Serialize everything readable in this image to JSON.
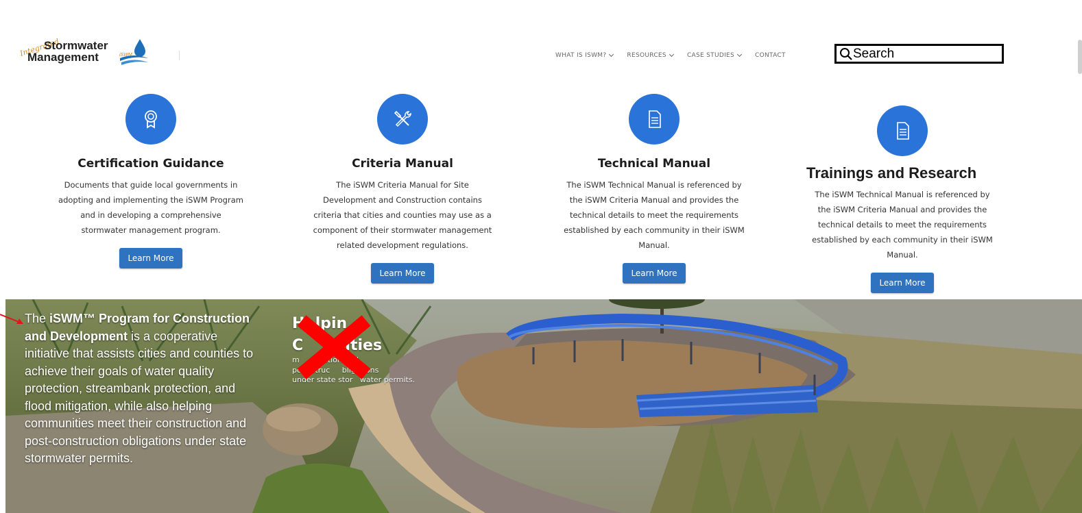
{
  "brand": {
    "script_text": "Integrated",
    "line1": "Stormwater",
    "line2": "Management",
    "mark_text": "iSWM"
  },
  "nav": [
    {
      "label": "WHAT IS ISWM?",
      "has_dropdown": true
    },
    {
      "label": "RESOURCES",
      "has_dropdown": true
    },
    {
      "label": "CASE STUDIES",
      "has_dropdown": true
    },
    {
      "label": "CONTACT",
      "has_dropdown": false
    }
  ],
  "search": {
    "placeholder": "Search"
  },
  "cards": [
    {
      "icon": "certificate-ribbon-icon",
      "title": "Certification Guidance",
      "desc_lines": [
        "Documents that guide local governments in",
        "adopting and implementing the iSWM Program",
        "and in developing a comprehensive",
        "stormwater management program."
      ],
      "button": "Learn More"
    },
    {
      "icon": "tools-icon",
      "title": "Criteria Manual",
      "desc_lines": [
        "The iSWM Criteria Manual for Site",
        "Development and Construction contains",
        "criteria that cities and counties may use as a",
        "component of their stormwater management",
        "related development regulations."
      ],
      "button": "Learn More"
    },
    {
      "icon": "document-icon",
      "title": "Technical Manual",
      "desc_lines": [
        "The iSWM Technical Manual is referenced by",
        "the iSWM Criteria Manual and provides the",
        "technical details to meet the requirements",
        "established by each community in their iSWM",
        "Manual."
      ],
      "button": "Learn More"
    },
    {
      "icon": "document-icon",
      "title": "Trainings and Research",
      "desc_lines": [
        "The iSWM Technical Manual is referenced by",
        "the iSWM Criteria Manual and provides the",
        "technical details to meet the requirements",
        "established by each community in their iSWM",
        "Manual."
      ],
      "button": "Learn More"
    }
  ],
  "hero": {
    "text_pre": "The ",
    "text_bold": "iSWM™ Program for Construction and Development",
    "text_post": " is a cooperative initiative that assists cities and counties to achieve their goals of water quality protection, streambank protection, and flood mitigation, while also helping communities meet their construction and post-construction obligations under state stormwater permits.",
    "heading": "Helping Communities",
    "heading_visible": "H  lpin\nC        ities",
    "sub_lines": [
      "m          ction and",
      "po    struc     bligations",
      "under state stor   water permits."
    ]
  },
  "colors": {
    "accent_blue": "#2a73d8",
    "button_blue": "#2f72c0",
    "annotation_red": "#ff0000"
  }
}
